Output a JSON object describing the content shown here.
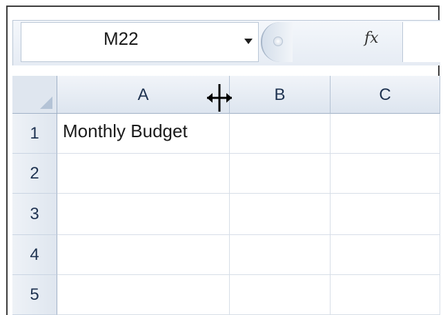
{
  "name_box": {
    "value": "M22"
  },
  "formula_bar": {
    "fx_label": "fx",
    "value": ""
  },
  "columns": [
    "A",
    "B",
    "C"
  ],
  "rows": [
    {
      "number": "1",
      "cells": [
        "Monthly Budget",
        "",
        ""
      ]
    },
    {
      "number": "2",
      "cells": [
        "",
        "",
        ""
      ]
    },
    {
      "number": "3",
      "cells": [
        "",
        "",
        ""
      ]
    },
    {
      "number": "4",
      "cells": [
        "",
        "",
        ""
      ]
    },
    {
      "number": "5",
      "cells": [
        "",
        "",
        ""
      ]
    }
  ],
  "icons": {
    "name_box_dropdown": "chevron-down-icon",
    "select_all": "select-all-triangle-icon",
    "cursor": "column-resize-cursor-icon"
  },
  "colors": {
    "header_text": "#1e3250",
    "header_bg": "#dde5ef",
    "grid_line": "#d6dde7"
  }
}
